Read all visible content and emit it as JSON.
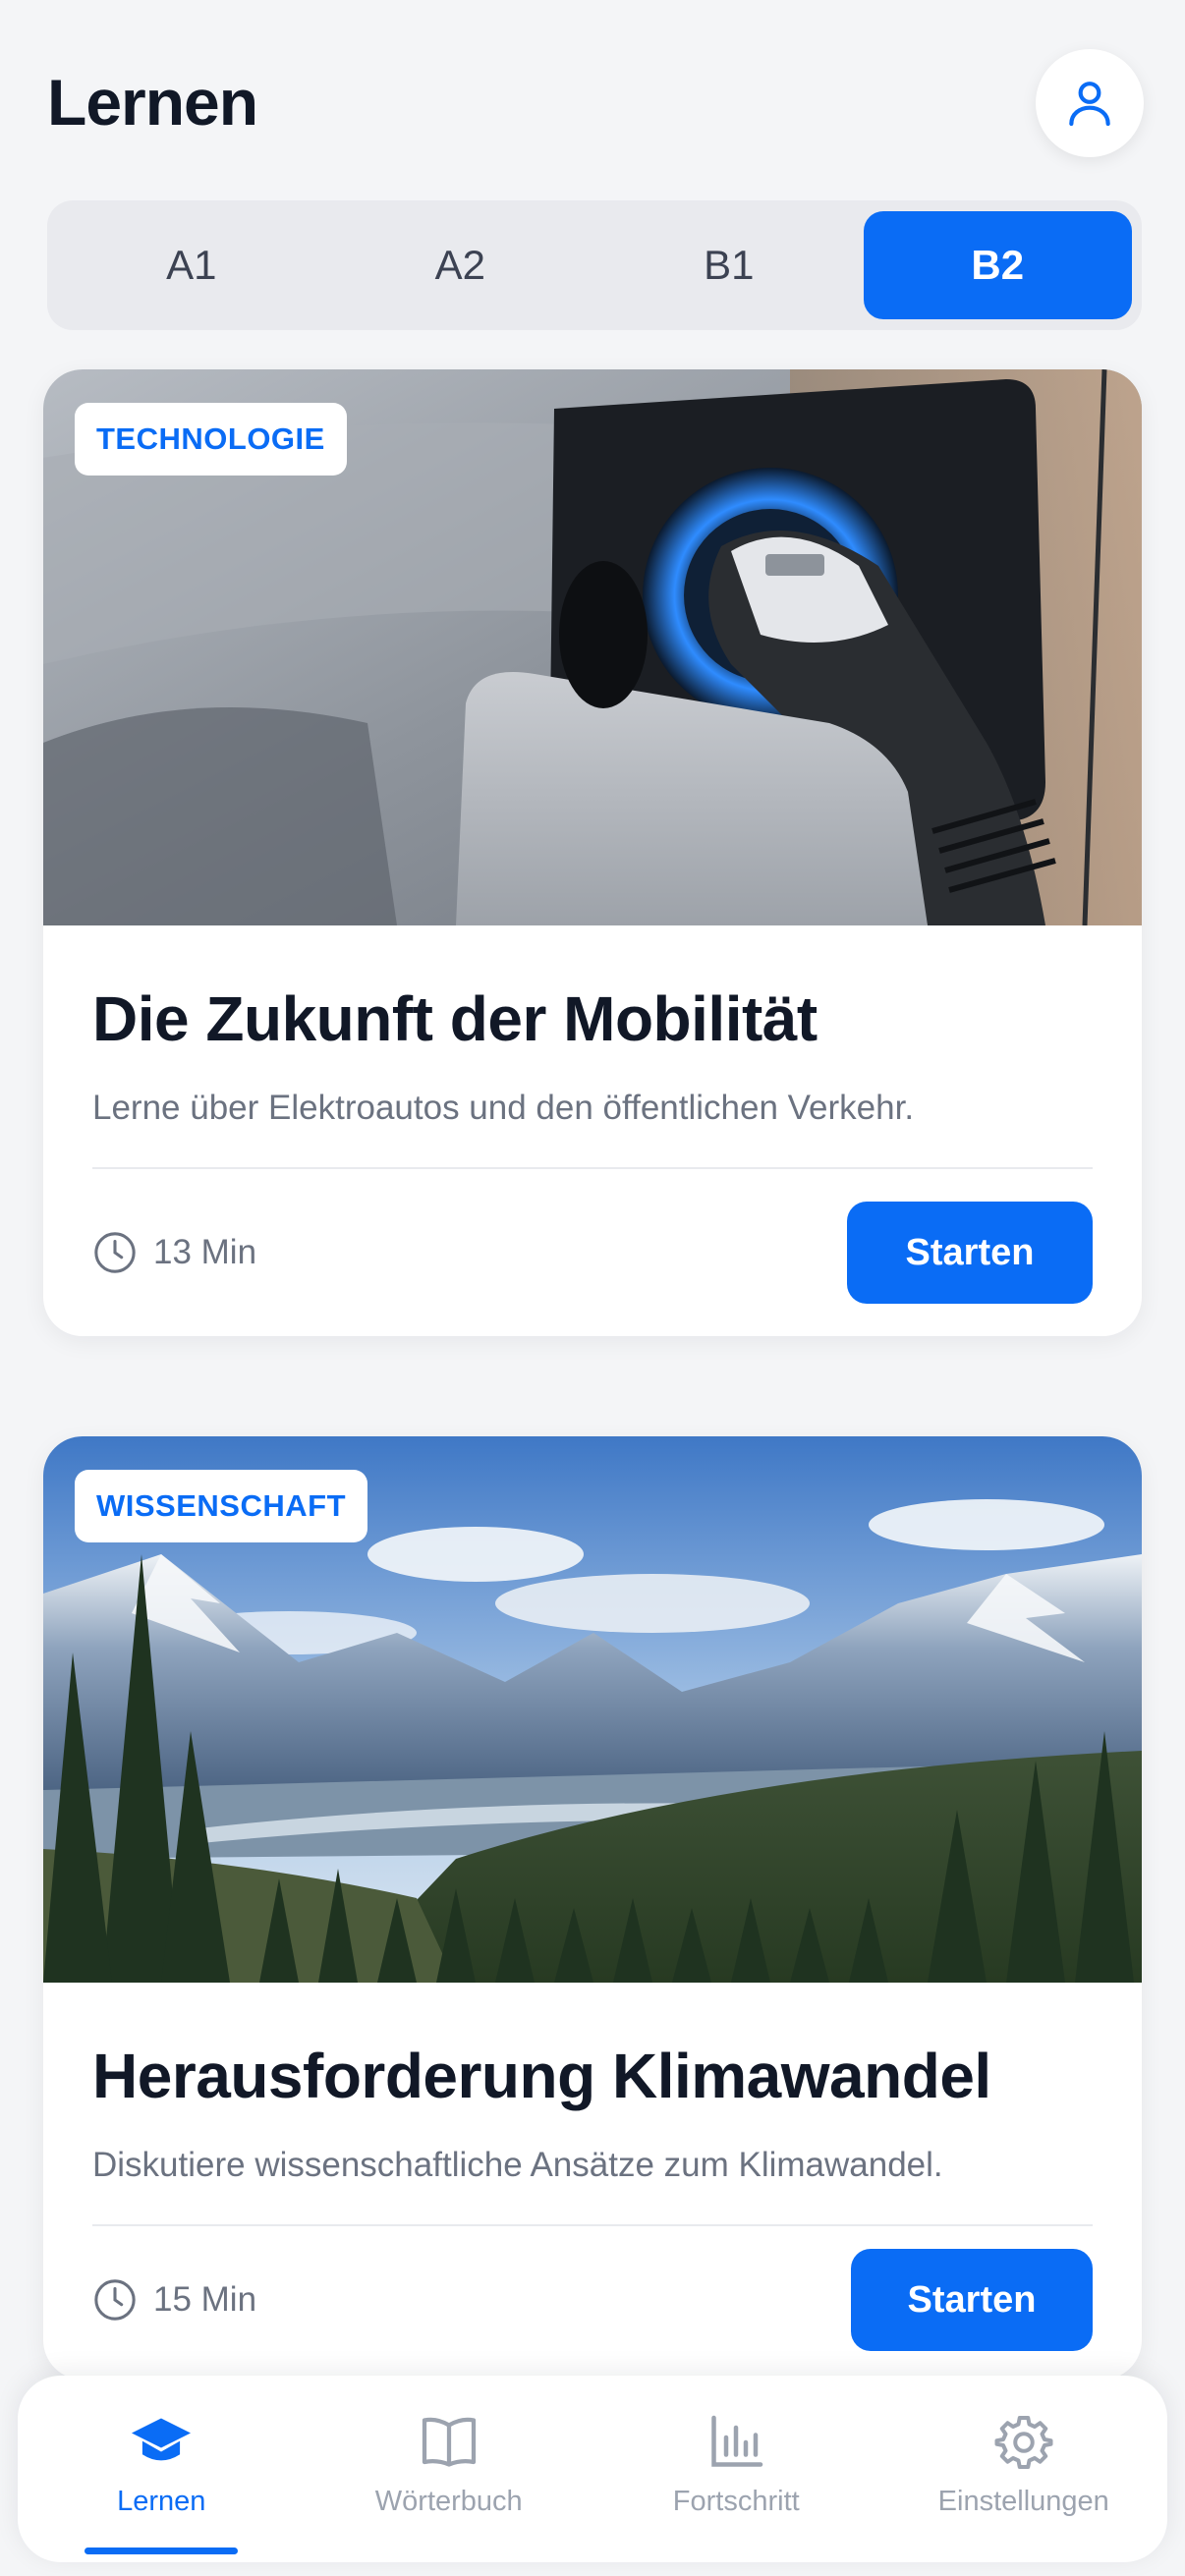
{
  "header": {
    "title": "Lernen",
    "profile_icon": "user-icon"
  },
  "levels": {
    "items": [
      "A1",
      "A2",
      "B1",
      "B2"
    ],
    "selected": "B2"
  },
  "cards": [
    {
      "tag": "TECHNOLOGIE",
      "image": "ev-charging-plug",
      "title": "Die Zukunft der Mobilität",
      "description": "Lerne über Elektroautos und den öffentlichen Verkehr.",
      "duration": "13 Min",
      "button": "Starten"
    },
    {
      "tag": "WISSENSCHAFT",
      "image": "mountain-valley-landscape",
      "title": "Herausforderung Klimawandel",
      "description": "Diskutiere wissenschaftliche Ansätze zum Klimawandel.",
      "duration": "15 Min",
      "button": "Starten"
    }
  ],
  "tabbar": {
    "items": [
      {
        "label": "Lernen",
        "icon": "graduation-cap-icon",
        "active": true
      },
      {
        "label": "Wörterbuch",
        "icon": "book-icon",
        "active": false
      },
      {
        "label": "Fortschritt",
        "icon": "bar-chart-icon",
        "active": false
      },
      {
        "label": "Einstellungen",
        "icon": "gear-icon",
        "active": false
      }
    ]
  },
  "colors": {
    "accent": "#0a6cf5",
    "background": "#f4f5f7",
    "text": "#111827",
    "muted": "#6b7280"
  }
}
